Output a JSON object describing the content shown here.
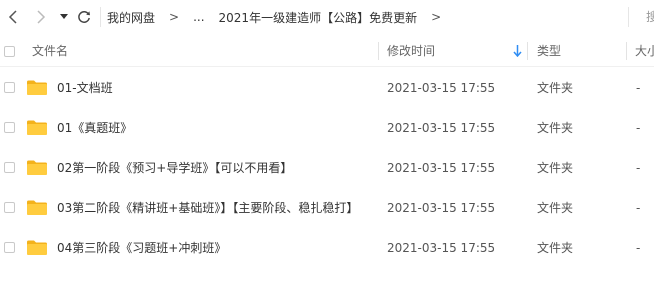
{
  "toolbar": {
    "back_icon": "chevron-left-icon",
    "forward_icon": "chevron-right-icon",
    "dropdown_icon": "caret-down-icon",
    "refresh_icon": "refresh-icon",
    "breadcrumbs": [
      "我的网盘",
      ">",
      "...",
      "2021年一级建造师【公路】免费更新",
      ">"
    ],
    "search_fragment": "搜"
  },
  "header": {
    "filename": "文件名",
    "modified": "修改时间",
    "type": "类型",
    "size": "大小",
    "sort_icon": "sort-down-arrow-icon",
    "sort_color": "#2f8df3"
  },
  "colors": {
    "folder": "#ffcc3f",
    "folder_back": "#f3b21c"
  },
  "files": [
    {
      "name": "01-文档班",
      "modified": "2021-03-15 17:55",
      "type": "文件夹",
      "size": "-"
    },
    {
      "name": "01《真题班》",
      "modified": "2021-03-15 17:55",
      "type": "文件夹",
      "size": "-"
    },
    {
      "name": "02第一阶段《预习+导学班》【可以不用看】",
      "modified": "2021-03-15 17:55",
      "type": "文件夹",
      "size": "-"
    },
    {
      "name": "03第二阶段《精讲班+基础班》】【主要阶段、稳扎稳打】",
      "modified": "2021-03-15 17:55",
      "type": "文件夹",
      "size": "-"
    },
    {
      "name": "04第三阶段《习题班+冲刺班》",
      "modified": "2021-03-15 17:55",
      "type": "文件夹",
      "size": "-"
    }
  ]
}
